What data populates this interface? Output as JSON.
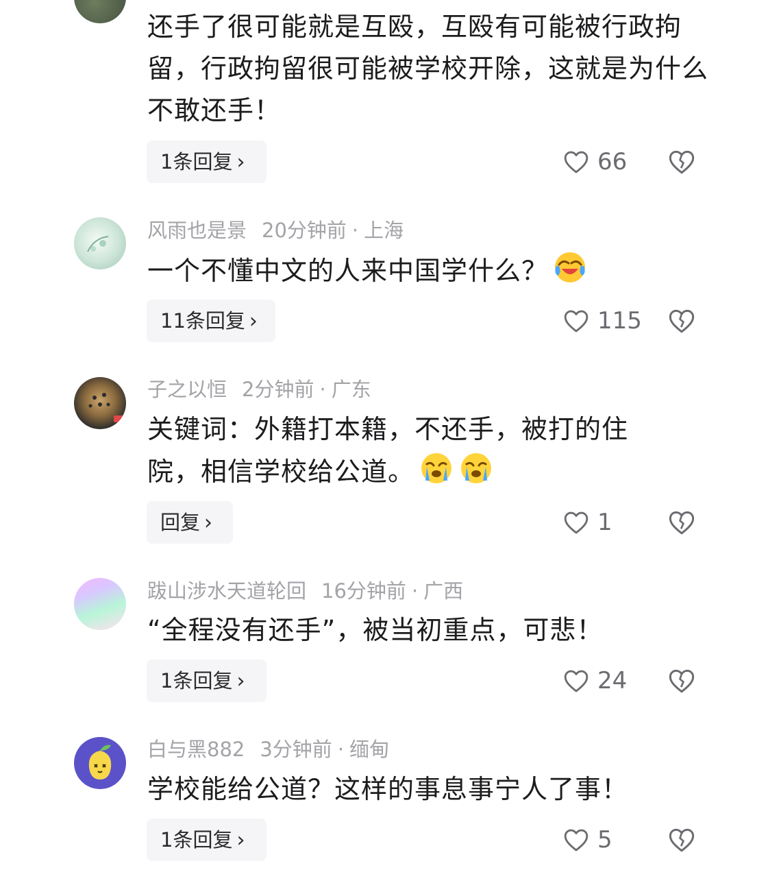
{
  "comments": [
    {
      "username": "",
      "time": "",
      "location": "",
      "text": "还手了很可能就是互殴，互殴有可能被行政拘留，行政拘留很可能被学校开除，这就是为什么不敢还手！",
      "reply_label": "1条回复",
      "likes": "66",
      "avatar_colors": [
        "#3f4a3c",
        "#6d7d5e"
      ]
    },
    {
      "username": "风雨也是景",
      "time": "20分钟前",
      "location": "上海",
      "text": "一个不懂中文的人来中国学什么？",
      "emoji": "laughing-crying-emoji",
      "reply_label": "11条回复",
      "likes": "115",
      "avatar_colors": [
        "#dfeee6",
        "#9cc7b3"
      ]
    },
    {
      "username": "子之以恒",
      "time": "2分钟前",
      "location": "广东",
      "text": "关键词：外籍打本籍，不还手，被打的住院，相信学校给公道。",
      "emoji": "crying-emoji",
      "reply_label": "回复",
      "likes": "1",
      "avatar_colors": [
        "#2b2b2b",
        "#c9a36b"
      ]
    },
    {
      "username": "跋山涉水天道轮回",
      "time": "16分钟前",
      "location": "广西",
      "text": "“全程没有还手”，被当初重点，可悲！",
      "reply_label": "1条回复",
      "likes": "24",
      "avatar_colors": [
        "#e6c6ff",
        "#b8f5d8"
      ]
    },
    {
      "username": "白与黑882",
      "time": "3分钟前",
      "location": "缅甸",
      "text": "学校能给公道？这样的事息事宁人了事！",
      "reply_label": "1条回复",
      "likes": "5",
      "avatar_colors": [
        "#5b52c9",
        "#f7d84a"
      ]
    }
  ],
  "icons": {
    "like": "heart-outline-icon",
    "dislike": "broken-heart-icon",
    "reply_chevron": "chevron-right-icon"
  }
}
